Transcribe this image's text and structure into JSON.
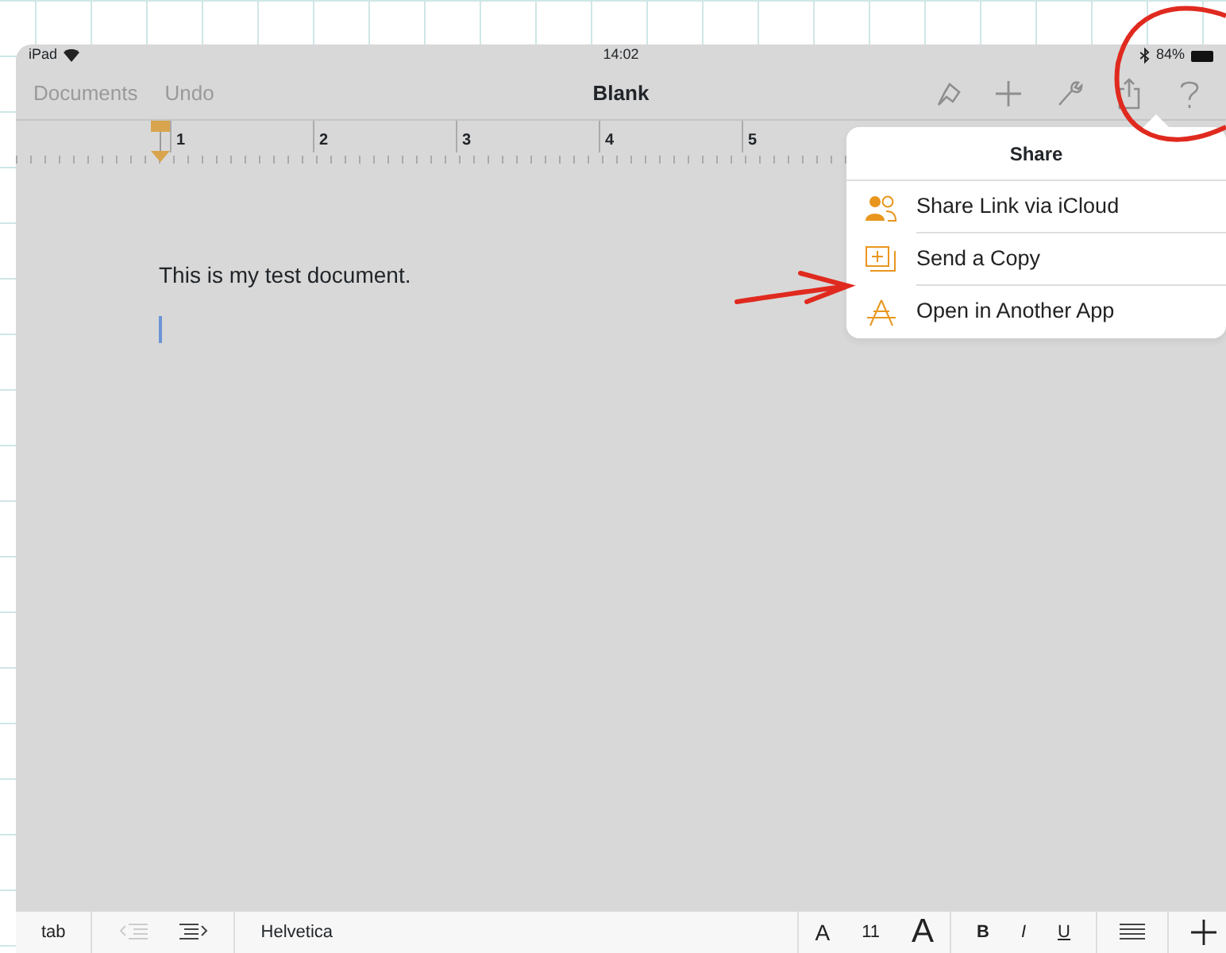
{
  "status_bar": {
    "device": "iPad",
    "time": "14:02",
    "battery": "84%"
  },
  "toolbar": {
    "left_buttons": [
      {
        "label": "Documents",
        "disabled": true
      },
      {
        "label": "Undo",
        "disabled": true
      }
    ],
    "title": "Blank"
  },
  "ruler": {
    "labels": [
      "1",
      "2",
      "3",
      "4",
      "5"
    ]
  },
  "document": {
    "paragraphs": [
      "This is my test document."
    ]
  },
  "share_popover": {
    "title": "Share",
    "items": [
      {
        "kind": "people",
        "label": "Share Link via iCloud"
      },
      {
        "kind": "copy",
        "label": "Send a Copy"
      },
      {
        "kind": "app",
        "label": "Open in Another App"
      }
    ]
  },
  "bottom_toolbar": {
    "tab_button": "tab",
    "indent_buttons": [
      {
        "kind": "outdent",
        "disabled": true
      },
      {
        "kind": "indent",
        "disabled": false
      }
    ],
    "font": "Helvetica",
    "size_buttons": [
      "A",
      "11",
      "A"
    ],
    "style_buttons": [
      "B",
      "I",
      "U"
    ]
  }
}
